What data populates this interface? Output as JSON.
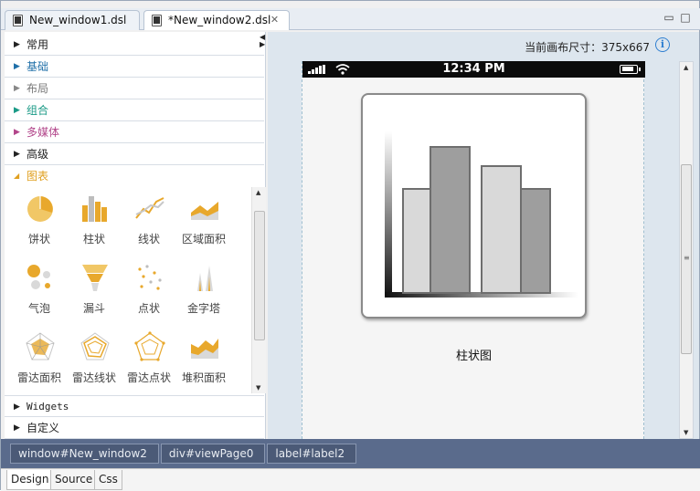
{
  "tabs": [
    {
      "label": "New_window1.dsl",
      "active": false
    },
    {
      "label": "*New_window2.dsl",
      "active": true
    }
  ],
  "palette": {
    "categories": [
      {
        "label": "常用",
        "color": "#222222"
      },
      {
        "label": "基础",
        "color": "#1f6fa8"
      },
      {
        "label": "布局",
        "color": "#777777"
      },
      {
        "label": "组合",
        "color": "#1a9a86"
      },
      {
        "label": "多媒体",
        "color": "#b2458a"
      },
      {
        "label": "高级",
        "color": "#222222"
      },
      {
        "label": "图表",
        "color": "#e0a020",
        "expanded": true
      }
    ],
    "chart_items": [
      {
        "label": "饼状",
        "icon": "pie-chart-icon"
      },
      {
        "label": "柱状",
        "icon": "bar-chart-icon"
      },
      {
        "label": "线状",
        "icon": "line-chart-icon"
      },
      {
        "label": "区域面积",
        "icon": "area-chart-icon"
      },
      {
        "label": "气泡",
        "icon": "bubble-chart-icon"
      },
      {
        "label": "漏斗",
        "icon": "funnel-chart-icon"
      },
      {
        "label": "点状",
        "icon": "scatter-chart-icon"
      },
      {
        "label": "金字塔",
        "icon": "pyramid-chart-icon"
      },
      {
        "label": "雷达面积",
        "icon": "radar-area-icon"
      },
      {
        "label": "雷达线状",
        "icon": "radar-line-icon"
      },
      {
        "label": "雷达点状",
        "icon": "radar-point-icon"
      },
      {
        "label": "堆积面积",
        "icon": "stacked-area-icon"
      }
    ],
    "bottom_categories": [
      {
        "label": "Widgets"
      },
      {
        "label": "自定义"
      }
    ]
  },
  "canvas": {
    "size_text": "当前画布尺寸：375x667",
    "status_time": "12:34 PM",
    "chart_caption": "柱状图"
  },
  "breadcrumb": [
    "window#New_window2",
    "div#viewPage0",
    "label#label2"
  ],
  "bottom_tabs": [
    {
      "label": "Design",
      "active": true
    },
    {
      "label": "Source",
      "active": false
    },
    {
      "label": "Css",
      "active": false
    }
  ],
  "colors": {
    "accent_orange": "#e8ad3c",
    "breadcrumb_bg": "#5a6b8c"
  }
}
